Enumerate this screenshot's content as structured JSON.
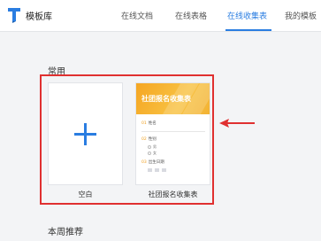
{
  "header": {
    "brand": "模板库",
    "tabs": [
      {
        "label": "在线文档"
      },
      {
        "label": "在线表格"
      },
      {
        "label": "在线收集表",
        "active": true
      },
      {
        "label": "我的模板"
      }
    ]
  },
  "sections": {
    "common": "常用",
    "weekly": "本周推荐"
  },
  "cards": {
    "blank": {
      "label": "空白",
      "icon": "plus-icon"
    },
    "template": {
      "label": "社团报名收集表",
      "preview": {
        "title": "社团报名收集表",
        "fields": [
          {
            "num": "01",
            "label": "姓名"
          },
          {
            "num": "02",
            "label": "性别",
            "options": [
              "男",
              "女"
            ]
          },
          {
            "num": "03",
            "label": "出生日期"
          }
        ]
      }
    }
  },
  "colors": {
    "accent": "#2a7de1",
    "highlight": "#e03030",
    "banner": "#f5a623"
  }
}
